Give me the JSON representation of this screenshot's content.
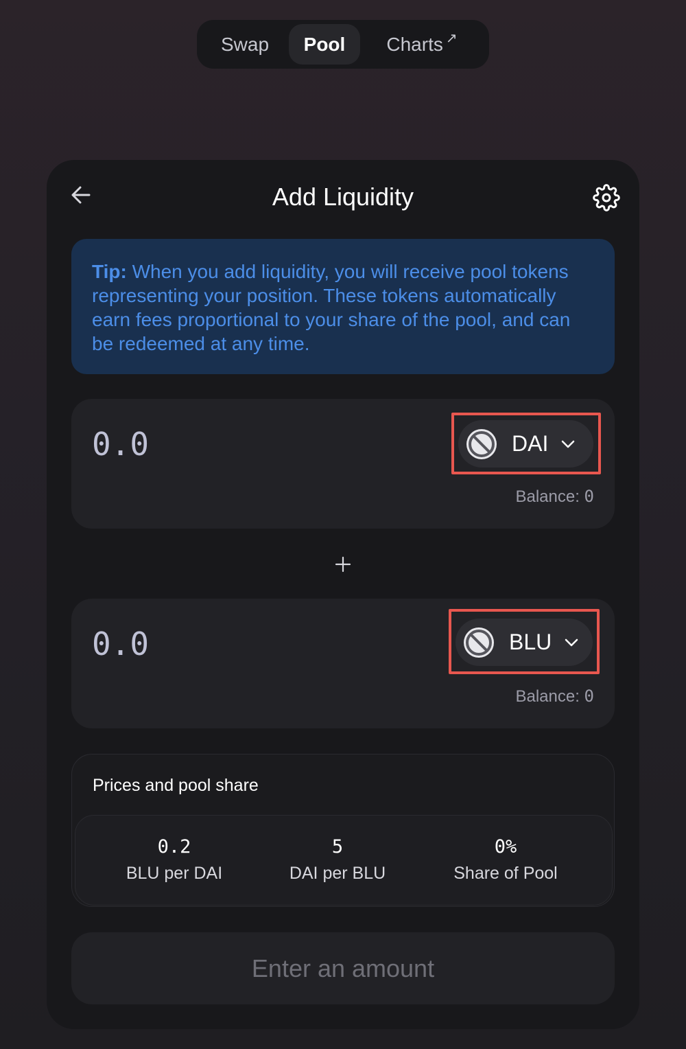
{
  "nav": {
    "tabs": [
      {
        "label": "Swap"
      },
      {
        "label": "Pool",
        "active": true
      },
      {
        "label": "Charts",
        "suffix": "↗"
      }
    ]
  },
  "card": {
    "title": "Add Liquidity",
    "tip": {
      "prefix": "Tip:",
      "text": " When you add liquidity, you will receive pool tokens representing your position. These tokens automatically earn fees proportional to your share of the pool, and can be redeemed at any time."
    },
    "inputs": [
      {
        "placeholder": "0.0",
        "token": "DAI",
        "balance_label": "Balance: ",
        "balance_value": "0"
      },
      {
        "placeholder": "0.0",
        "token": "BLU",
        "balance_label": "Balance: ",
        "balance_value": "0"
      }
    ],
    "plus": "+",
    "prices": {
      "title": "Prices and pool share",
      "items": [
        {
          "value": "0.2",
          "label": "BLU per DAI"
        },
        {
          "value": "5",
          "label": "DAI per BLU"
        },
        {
          "value": "0%",
          "label": "Share of Pool"
        }
      ]
    },
    "submit_label": "Enter an amount"
  },
  "colors": {
    "accent_blue": "#4c8ee8",
    "tip_background": "#19304f",
    "highlight_outline": "#e8574f"
  }
}
